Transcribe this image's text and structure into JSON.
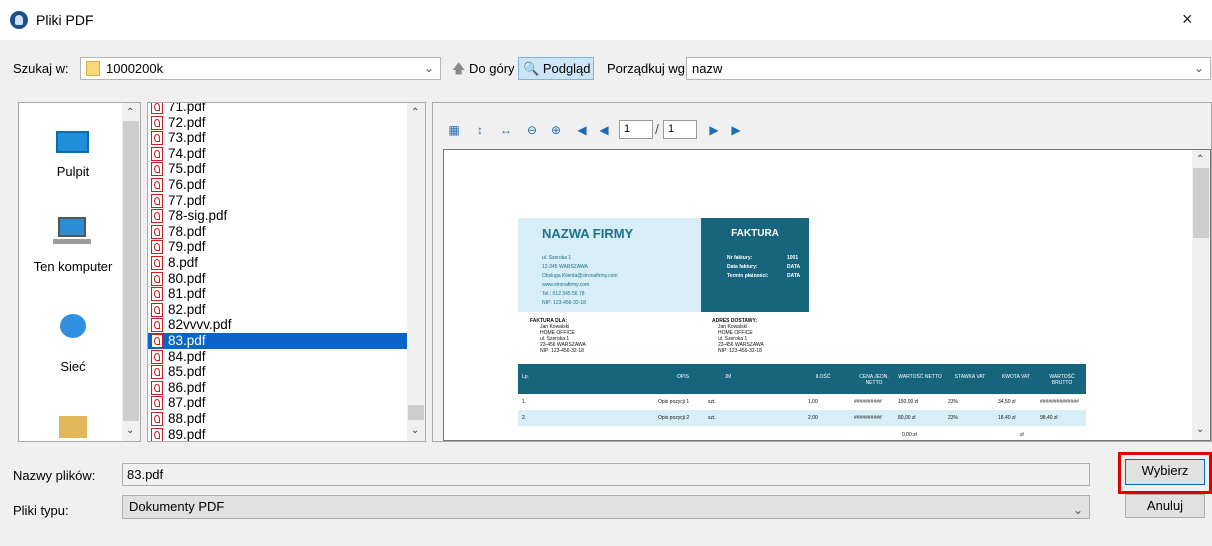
{
  "window": {
    "title": "Pliki PDF",
    "close": "×"
  },
  "toolbar": {
    "search_label": "Szukaj w:",
    "folder": "1000200k",
    "up_label": "Do góry",
    "preview_label": "Podgląd",
    "sort_label": "Porządkuj wg:",
    "sort_value": "nazw"
  },
  "places": [
    {
      "label": "Pulpit",
      "icon": "desktop-icon"
    },
    {
      "label": "Ten komputer",
      "icon": "computer-icon"
    },
    {
      "label": "Sieć",
      "icon": "network-icon"
    },
    {
      "label": "",
      "icon": "user-folder-icon"
    }
  ],
  "files": [
    "71.pdf",
    "72.pdf",
    "73.pdf",
    "74.pdf",
    "75.pdf",
    "76.pdf",
    "77.pdf",
    "78-sig.pdf",
    "78.pdf",
    "79.pdf",
    "8.pdf",
    "80.pdf",
    "81.pdf",
    "82.pdf",
    "82vvvv.pdf",
    "83.pdf",
    "84.pdf",
    "85.pdf",
    "86.pdf",
    "87.pdf",
    "88.pdf",
    "89.pdf"
  ],
  "selected_file": "83.pdf",
  "viewer": {
    "page": "1",
    "total": "1"
  },
  "invoice": {
    "company": "NAZWA FIRMY",
    "header": "FAKTURA",
    "address_lines": [
      "ul. Szeroka 1",
      "12-345 WARSZAWA",
      "Obsluga Klienta@stronafirmy.com",
      "www.stronafirmy.com",
      "Tel.: 012 345 56 78",
      "NIP: 123-456-32-18"
    ],
    "meta_labels": [
      "Nr faktury:",
      "Data faktury:",
      "Termin płatności:"
    ],
    "meta_values": [
      "1001",
      "DATA",
      "DATA"
    ],
    "bill_to_title": "FAKTURA DLA:",
    "bill_to": [
      "Jan Kowalski",
      "HOME OFFICE",
      "ul. Szeroka 1",
      "23-456 WARSZAWA",
      "NIP: 123-456-32-18"
    ],
    "ship_to_title": "ADRES DOSTAWY:",
    "ship_to": [
      "Jan Kowalski",
      "HOME OFFICE",
      "ul. Szeroka 1",
      "23-456 WARSZAWA",
      "NIP: 123-456-32-18"
    ],
    "columns": [
      "Lp.",
      "OPIS",
      "JM",
      "ILOŚĆ",
      "CENA JEDN. NETTO",
      "WARTOŚĆ NETTO",
      "STAWKA VAT",
      "KWOTA VAT",
      "WARTOŚĆ BRUTTO"
    ],
    "rows": [
      [
        "1.",
        "Opis pozycji 1",
        "szt.",
        "1,00",
        "##########",
        "150,00 zł",
        "23%",
        "34,50 zł",
        "##############"
      ],
      [
        "2.",
        "Opis pozycji 2",
        "szt.",
        "2,00",
        "##########",
        "80,00 zł",
        "23%",
        "18,40 zł",
        "98,40 zł"
      ]
    ],
    "partial_row": [
      "0,00 zł",
      "zł"
    ]
  },
  "bottom": {
    "filename_label": "Nazwy plików:",
    "filename_value": "83.pdf",
    "type_label": "Pliki typu:",
    "type_value": "Dokumenty PDF",
    "select_button": "Wybierz",
    "cancel_button": "Anuluj"
  },
  "colors": {
    "accent": "#0a64c8",
    "invoice_teal": "#17657d",
    "invoice_light": "#d7eef8",
    "highlight_red": "#e00000"
  }
}
